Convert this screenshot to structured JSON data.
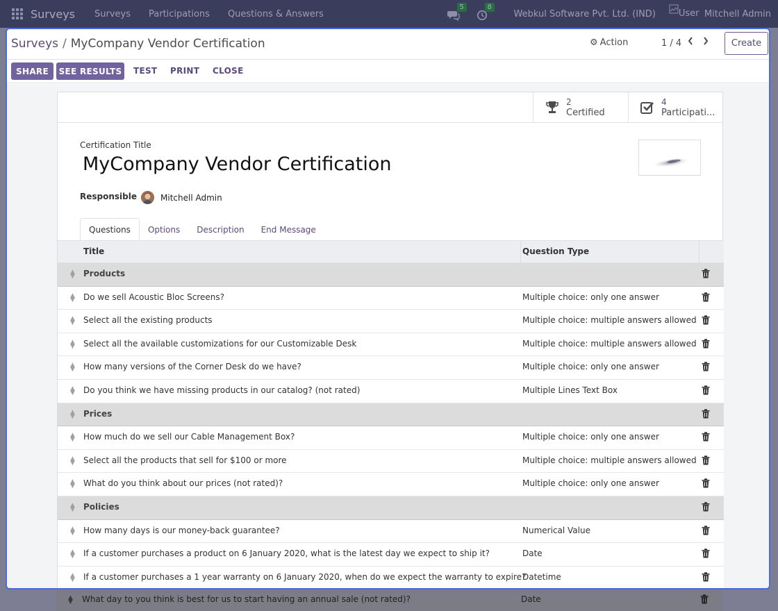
{
  "navbar": {
    "brand": "Surveys",
    "menus": [
      "Surveys",
      "Participations",
      "Questions & Answers"
    ],
    "messages_count": "5",
    "activities_count": "8",
    "company": "Webkul Software Pvt. Ltd. (IND)",
    "user_img_alt": "User",
    "user_name": "Mitchell Admin"
  },
  "control_panel": {
    "breadcrumb_parent": "Surveys",
    "breadcrumb_separator": "/",
    "breadcrumb_current": "MyCompany Vendor Certification",
    "action_label": "Action",
    "pager": "1 / 4",
    "create_label": "Create"
  },
  "toolbar": {
    "share_label": "SHARE",
    "see_results_label": "SEE RESULTS",
    "test_label": "TEST",
    "print_label": "PRINT",
    "close_label": "CLOSE"
  },
  "stats": {
    "certified_count": "2",
    "certified_label": "Certified",
    "participations_count": "4",
    "participations_label": "Participati..."
  },
  "form": {
    "title_label": "Certification Title",
    "title": "MyCompany Vendor Certification",
    "responsible_label": "Responsible",
    "responsible_name": "Mitchell Admin"
  },
  "tabs": [
    "Questions",
    "Options",
    "Description",
    "End Message"
  ],
  "list": {
    "col_title": "Title",
    "col_type": "Question Type",
    "rows": [
      {
        "section": true,
        "title": "Products",
        "type": ""
      },
      {
        "section": false,
        "title": "Do we sell Acoustic Bloc Screens?",
        "type": "Multiple choice: only one answer"
      },
      {
        "section": false,
        "title": "Select all the existing products",
        "type": "Multiple choice: multiple answers allowed"
      },
      {
        "section": false,
        "title": "Select all the available customizations for our Customizable Desk",
        "type": "Multiple choice: multiple answers allowed"
      },
      {
        "section": false,
        "title": "How many versions of the Corner Desk do we have?",
        "type": "Multiple choice: only one answer"
      },
      {
        "section": false,
        "title": "Do you think we have missing products in our catalog? (not rated)",
        "type": "Multiple Lines Text Box"
      },
      {
        "section": true,
        "title": "Prices",
        "type": ""
      },
      {
        "section": false,
        "title": "How much do we sell our Cable Management Box?",
        "type": "Multiple choice: only one answer"
      },
      {
        "section": false,
        "title": "Select all the products that sell for $100 or more",
        "type": "Multiple choice: multiple answers allowed"
      },
      {
        "section": false,
        "title": "What do you think about our prices (not rated)?",
        "type": "Multiple choice: only one answer"
      },
      {
        "section": true,
        "title": "Policies",
        "type": ""
      },
      {
        "section": false,
        "title": "How many days is our money-back guarantee?",
        "type": "Numerical Value"
      },
      {
        "section": false,
        "title": "If a customer purchases a product on 6 January 2020, what is the latest day we expect to ship it?",
        "type": "Date"
      },
      {
        "section": false,
        "title": "If a customer purchases a 1 year warranty on 6 January 2020, when do we expect the warranty to expire?",
        "type": "Datetime"
      }
    ],
    "overflow_row": {
      "title": "What day to you think is best for us to start having an annual sale (not rated)?",
      "type": "Date"
    }
  },
  "colors": {
    "primary": "#71639e",
    "link": "#5a4a7a",
    "dialog_border": "#4a6bd8",
    "section_row": "#dcdcdc"
  }
}
